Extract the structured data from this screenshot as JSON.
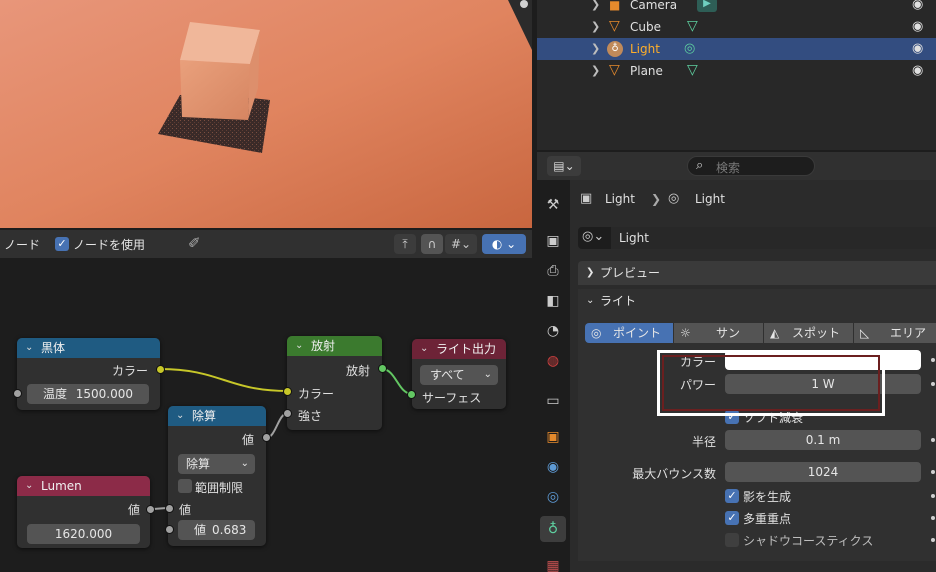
{
  "node_editor": {
    "header": {
      "menu": "ノード",
      "use_nodes_label": "ノードを使用"
    },
    "nodes": {
      "blackbody": {
        "title": "黒体",
        "out_color": "カラー",
        "temp_label": "温度",
        "temp_value": "1500.000"
      },
      "emission": {
        "title": "放射",
        "out": "放射",
        "in_color": "カラー",
        "in_strength": "強さ"
      },
      "light_output": {
        "title": "ライト出力",
        "target": "すべて",
        "in_surface": "サーフェス"
      },
      "divide": {
        "title": "除算",
        "out_value": "値",
        "operation": "除算",
        "clamp_label": "範囲制限",
        "in_value": "値",
        "value_label": "値",
        "value": "0.683"
      },
      "lumen": {
        "title": "Lumen",
        "out_value": "値",
        "value": "1620.000"
      }
    }
  },
  "outliner": {
    "items": [
      {
        "label": "Camera",
        "icon": "camera-icon"
      },
      {
        "label": "Cube",
        "icon": "mesh-icon"
      },
      {
        "label": "Light",
        "icon": "light-icon",
        "selected": true
      },
      {
        "label": "Plane",
        "icon": "mesh-icon"
      }
    ]
  },
  "properties": {
    "search_placeholder": "検索",
    "breadcrumb": {
      "object": "Light",
      "data": "Light"
    },
    "datablock_name": "Light",
    "panels": {
      "preview": "プレビュー",
      "light": "ライト"
    },
    "light_types": [
      "ポイント",
      "サン",
      "スポット",
      "エリア"
    ],
    "fields": {
      "color_label": "カラー",
      "power_label": "パワー",
      "power_value": "1 W",
      "soft_falloff_label": "ソフト減衰",
      "radius_label": "半径",
      "radius_value": "0.1 m",
      "max_bounces_label": "最大バウンス数",
      "max_bounces_value": "1024",
      "cast_shadow_label": "影を生成",
      "multi_importance_label": "多重重点",
      "shadow_caustics_label": "シャドウコースティクス"
    }
  },
  "colors": {
    "blackbody_header": "#1f5b82",
    "emission_header": "#3b7a2e",
    "output_header": "#6d2337",
    "divide_header": "#1f5b82",
    "lumen_header": "#8c2b48",
    "selection": "#334d80",
    "accent": "#4772b3",
    "highlight_box": "#6b1f1f"
  }
}
